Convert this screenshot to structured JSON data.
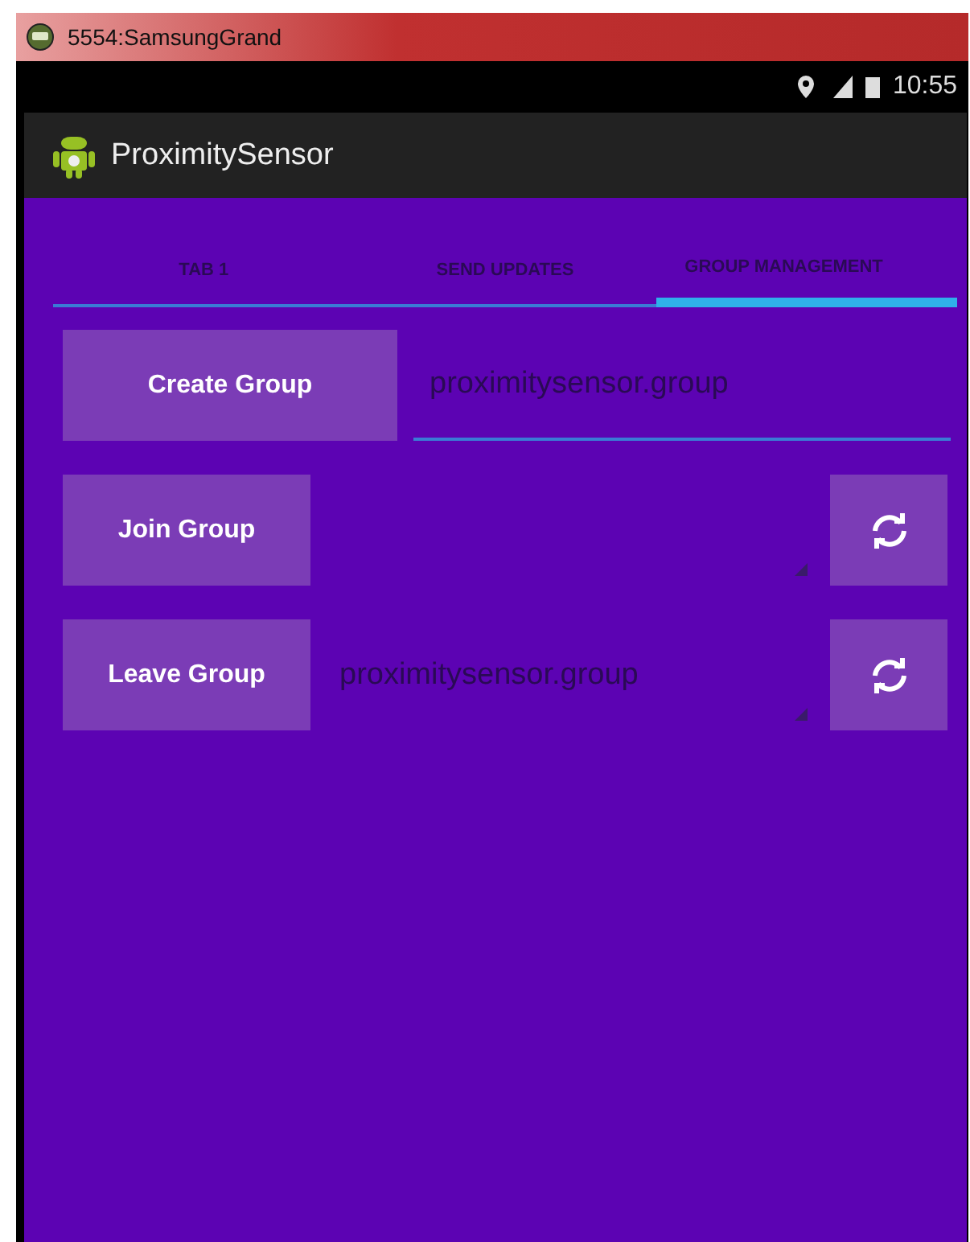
{
  "window": {
    "title": "5554:SamsungGrand"
  },
  "status_bar": {
    "time": "10:55"
  },
  "action_bar": {
    "title": "ProximitySensor"
  },
  "tabs": [
    {
      "label": "TAB 1",
      "selected": false
    },
    {
      "label": "SEND UPDATES",
      "selected": false
    },
    {
      "label": "GROUP MANAGEMENT",
      "selected": true
    }
  ],
  "rows": [
    {
      "kind": "field",
      "button": "Create Group",
      "value": "proximitysensor.group"
    },
    {
      "kind": "spinner",
      "button": "Join Group"
    },
    {
      "kind": "spinner",
      "button": "Leave Group",
      "value": "proximitysensor.group"
    }
  ]
}
